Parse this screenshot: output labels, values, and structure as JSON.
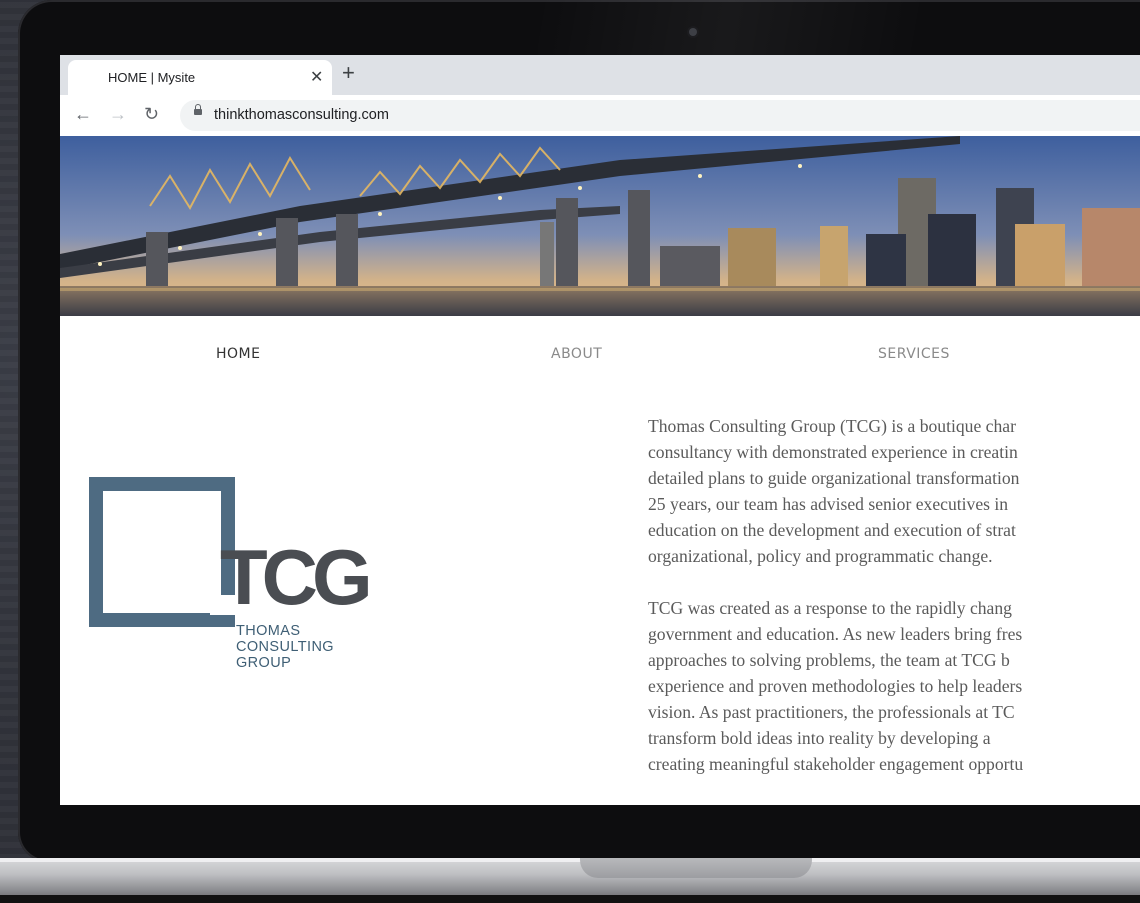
{
  "browser": {
    "tab_title": "HOME | Mysite",
    "tab_close_icon": "close-icon",
    "new_tab_icon": "plus-icon",
    "url": "thinkthomasconsulting.com",
    "nav_icons": [
      "back-arrow-icon",
      "forward-arrow-icon",
      "reload-icon",
      "lock-icon"
    ]
  },
  "site_nav": {
    "home": "HOME",
    "about": "ABOUT",
    "services": "SERVICES"
  },
  "logo": {
    "mark": "TCG",
    "line1": "THOMAS",
    "line2": "CONSULTING",
    "line3": "GROUP",
    "color": "#4e6b82"
  },
  "content": {
    "para1": [
      "Thomas Consulting Group (TCG) is a boutique char",
      "consultancy with demonstrated experience in creatin",
      "detailed plans to guide organizational transformation",
      "25 years, our team has advised senior executives in",
      "education on the development and execution of strat",
      "organizational, policy and programmatic change."
    ],
    "para2": [
      "TCG was created as a response to the rapidly chang",
      "government and education. As new leaders bring fres",
      "approaches to solving problems, the team at TCG b",
      "experience and proven methodologies to help leaders",
      "vision. As past practitioners, the professionals at TC",
      "transform bold ideas into reality by developing a",
      "creating meaningful stakeholder engagement opportu"
    ]
  }
}
